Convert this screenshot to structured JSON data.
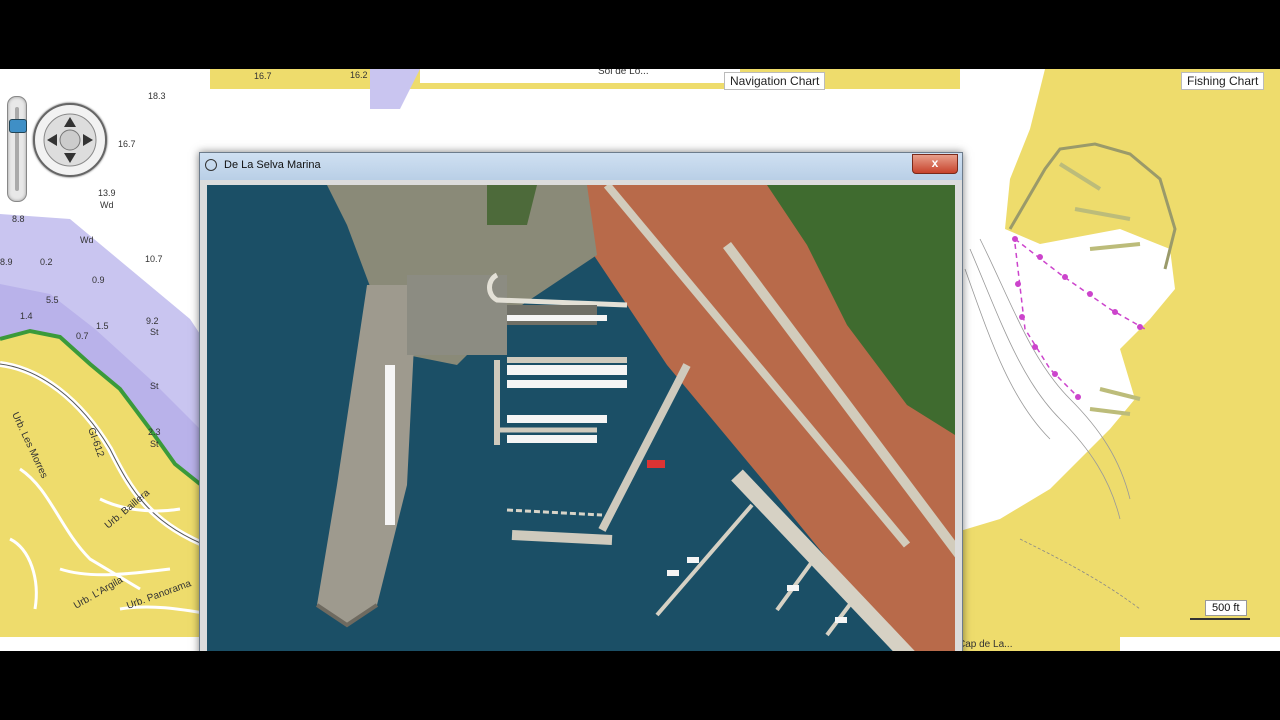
{
  "window": {
    "title": "De La Selva Marina",
    "close_label": "x"
  },
  "charts": {
    "navigation_label": "Navigation Chart",
    "fishing_label": "Fishing Chart",
    "scale_label": "500 ft",
    "top_partial_text": "Sol de Lo...",
    "bottom_partial_text": "Cap de La..."
  },
  "depths": [
    "16.7",
    "16.2",
    "18.3",
    "16.7",
    "13.9",
    "Wd",
    "8.8",
    "Wd",
    "10.7",
    "0.2",
    "0.9",
    "8.9",
    "5.5",
    "1.4",
    "1.5",
    "9.2",
    "St",
    "0.7",
    "St",
    "2.3",
    "St"
  ],
  "places": {
    "road": "GI-612",
    "urb_les_morres": "Urb. Les Morres",
    "urb_baillera": "Urb. Baillera",
    "urb_largila": "Urb. L'Argila",
    "urb_panorama": "Urb. Panorama"
  },
  "icons": {
    "pan_control": "pan-compass-icon",
    "zoom_control": "zoom-slider-icon",
    "window_icon": "globe-icon",
    "close": "close-icon"
  },
  "colors": {
    "land": "#eedc6c",
    "shallow_water": "#c9c5f0",
    "deep_water": "#ffffff",
    "route": "#cc44cc",
    "sea_photo": "#1b4f66"
  }
}
